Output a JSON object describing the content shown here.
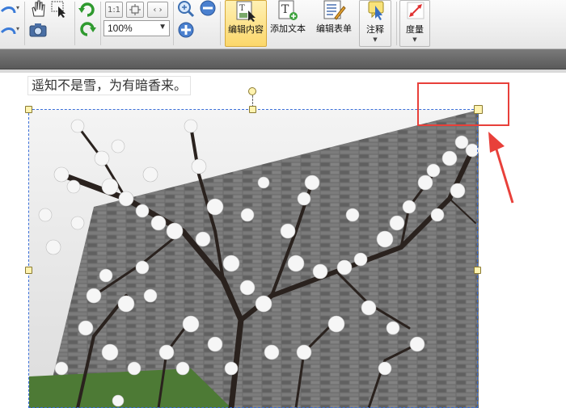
{
  "toolbar": {
    "zoom_value": "100%",
    "zoom_small_label": "1:1",
    "buttons": {
      "edit_content": "编辑内容",
      "add_text": "添加文本",
      "edit_form": "编辑表单",
      "annotate": "注释",
      "measure": "度量"
    }
  },
  "document": {
    "poem_line": "遥知不是雪，为有暗香来。"
  },
  "colors": {
    "accent_highlight": "#e8403a",
    "active_button": "#fbd76b",
    "selection_border": "#3a6fd8"
  },
  "icons": [
    "redo-icon",
    "hand-tool-icon",
    "select-tool-icon",
    "rotate-cw-icon",
    "rotate-ccw-icon",
    "camera-icon",
    "fit-page-icon",
    "zoom-in-icon",
    "zoom-out-icon",
    "edit-content-icon",
    "add-text-icon",
    "edit-form-icon",
    "annotate-icon",
    "measure-icon",
    "red-arrow-annotation-icon"
  ]
}
